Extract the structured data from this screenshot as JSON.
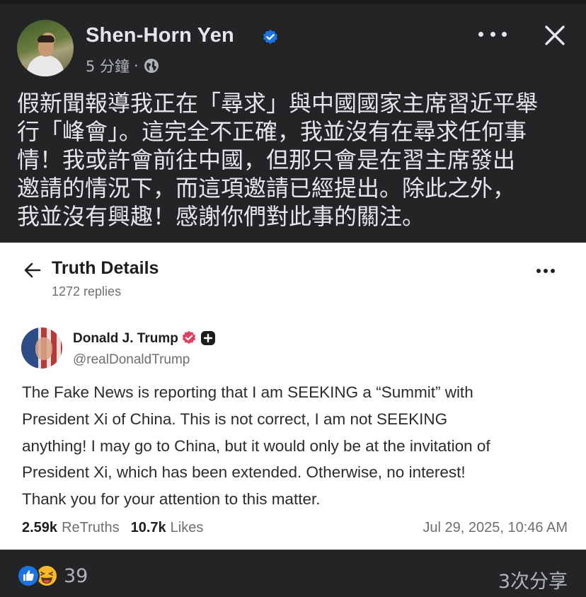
{
  "post": {
    "author": "Shen-Horn Yen",
    "time": "5 分鐘",
    "privacy_icon": "globe-icon",
    "text_lines": [
      "假新聞報導我正在「尋求」與中國國家主席習近平舉",
      "行「峰會」。這完全不正確，我並沒有在尋求任何事",
      "情！我或許會前往中國，但那只會是在習主席發出",
      "邀請的情況下，而這項邀請已經提出。除此之外，",
      "我並沒有興趣！感謝你們對此事的關注。"
    ]
  },
  "embed": {
    "title": "Truth Details",
    "replies": "1272 replies",
    "author_name": "Donald J. Trump",
    "handle": "@realDonaldTrump",
    "body_lines": [
      "The Fake News is reporting that I am SEEKING a “Summit” with",
      "President Xi of China. This is not correct, I am not SEEKING",
      "anything! I may go to China, but it would only be at the invitation of",
      "President Xi, which has been extended. Otherwise, no interest!",
      "Thank you for your attention to this matter."
    ],
    "retruths_count": "2.59k",
    "retruths_label": "ReTruths",
    "likes_count": "10.7k",
    "likes_label": "Likes",
    "date": "Jul 29, 2025, 10:46 AM"
  },
  "footer": {
    "reaction_count": "39",
    "shares": "3次分享"
  },
  "colors": {
    "background": "#232426",
    "verified_blue": "#1b74e4",
    "truth_verified": "#e0405e",
    "text_primary": "#e4e6eb",
    "text_secondary": "#b0b3b8"
  }
}
